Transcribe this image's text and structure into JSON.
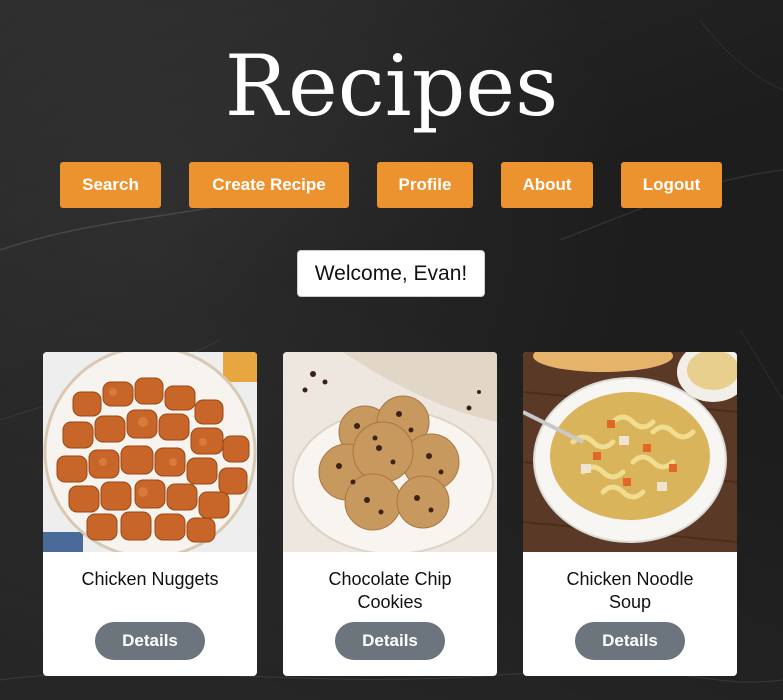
{
  "header": {
    "title": "Recipes"
  },
  "nav": {
    "search": "Search",
    "create": "Create Recipe",
    "profile": "Profile",
    "about": "About",
    "logout": "Logout"
  },
  "welcome": "Welcome, Evan!",
  "recipes": [
    {
      "title": "Chicken Nuggets",
      "button": "Details",
      "image": "chicken-nuggets-photo"
    },
    {
      "title": "Chocolate Chip Cookies",
      "button": "Details",
      "image": "chocolate-chip-cookies-photo"
    },
    {
      "title": "Chicken Noodle Soup",
      "button": "Details",
      "image": "chicken-noodle-soup-photo"
    }
  ],
  "colors": {
    "nav_button": "#ec922e",
    "details_button": "#6c757d",
    "background": "#222222"
  }
}
